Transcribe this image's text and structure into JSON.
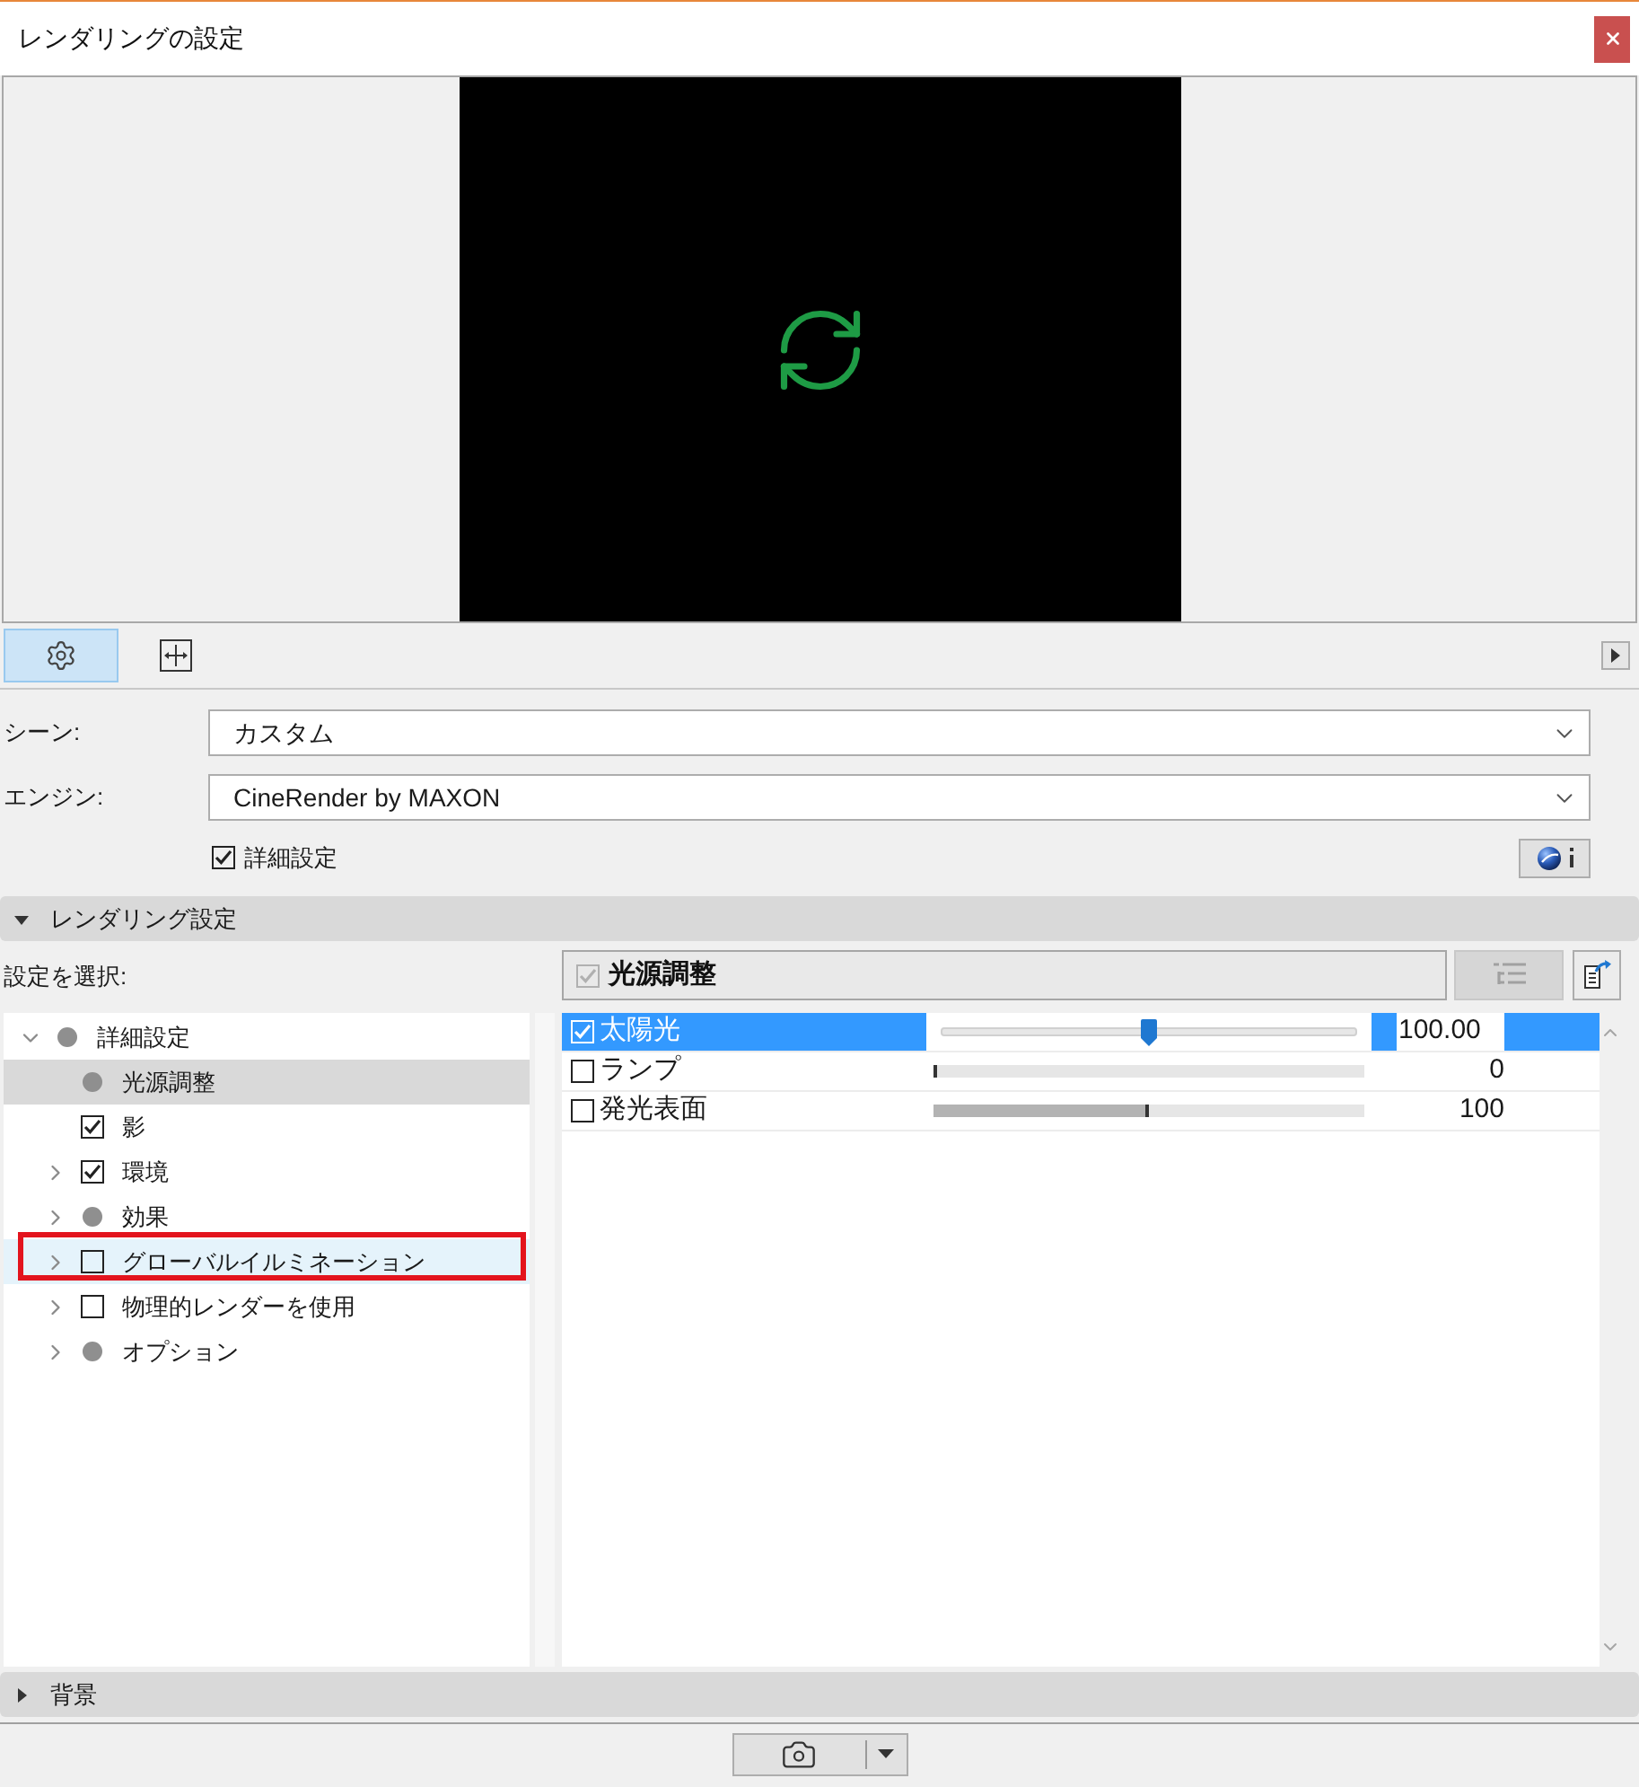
{
  "window": {
    "title": "レンダリングの設定"
  },
  "view_tabs": [
    {
      "kind": "settings",
      "selected": true
    },
    {
      "kind": "size",
      "selected": false
    }
  ],
  "form": {
    "fields": [
      {
        "label": "シーン:",
        "value": "カスタム"
      },
      {
        "label": "エンジン:",
        "value": "CineRender by MAXON"
      }
    ],
    "detail_toggle": {
      "label": "詳細設定",
      "checked": true
    }
  },
  "render_section": {
    "title": "レンダリング設定",
    "expanded": true
  },
  "tree_label": "設定を選択:",
  "tree": [
    {
      "label": "詳細設定",
      "kind": "dot",
      "expanded": true,
      "selected": false,
      "highlighted": false,
      "annotated": false,
      "children": [
        {
          "label": "光源調整",
          "kind": "dot",
          "selected": true,
          "highlighted": false,
          "annotated": false
        },
        {
          "label": "影",
          "kind": "checkbox",
          "checked": true,
          "selected": false,
          "highlighted": false,
          "annotated": false
        },
        {
          "label": "環境",
          "kind": "checkbox",
          "checked": true,
          "expanded": false,
          "selected": false,
          "highlighted": false,
          "annotated": false
        },
        {
          "label": "効果",
          "kind": "dot",
          "expanded": false,
          "selected": false,
          "highlighted": false,
          "annotated": false
        },
        {
          "label": "グローバルイルミネーション",
          "kind": "checkbox",
          "checked": false,
          "expanded": false,
          "selected": false,
          "highlighted": true,
          "annotated": true
        },
        {
          "label": "物理的レンダーを使用",
          "kind": "checkbox",
          "checked": false,
          "expanded": false,
          "selected": false,
          "highlighted": false,
          "annotated": false
        },
        {
          "label": "オプション",
          "kind": "dot",
          "expanded": false,
          "selected": false,
          "highlighted": false,
          "annotated": false
        }
      ]
    }
  ],
  "detail_header": {
    "label": "光源調整",
    "checked": true,
    "disabled": true
  },
  "light_rows": [
    {
      "label": "太陽光",
      "checked": true,
      "selected": true,
      "level": 0.5,
      "value": "100.00"
    },
    {
      "label": "ランプ",
      "checked": false,
      "selected": false,
      "level": 0,
      "value": "0"
    },
    {
      "label": "発光表面",
      "checked": false,
      "selected": false,
      "level": 0.5,
      "value": "100"
    }
  ],
  "background_section": {
    "title": "背景",
    "expanded": false
  }
}
